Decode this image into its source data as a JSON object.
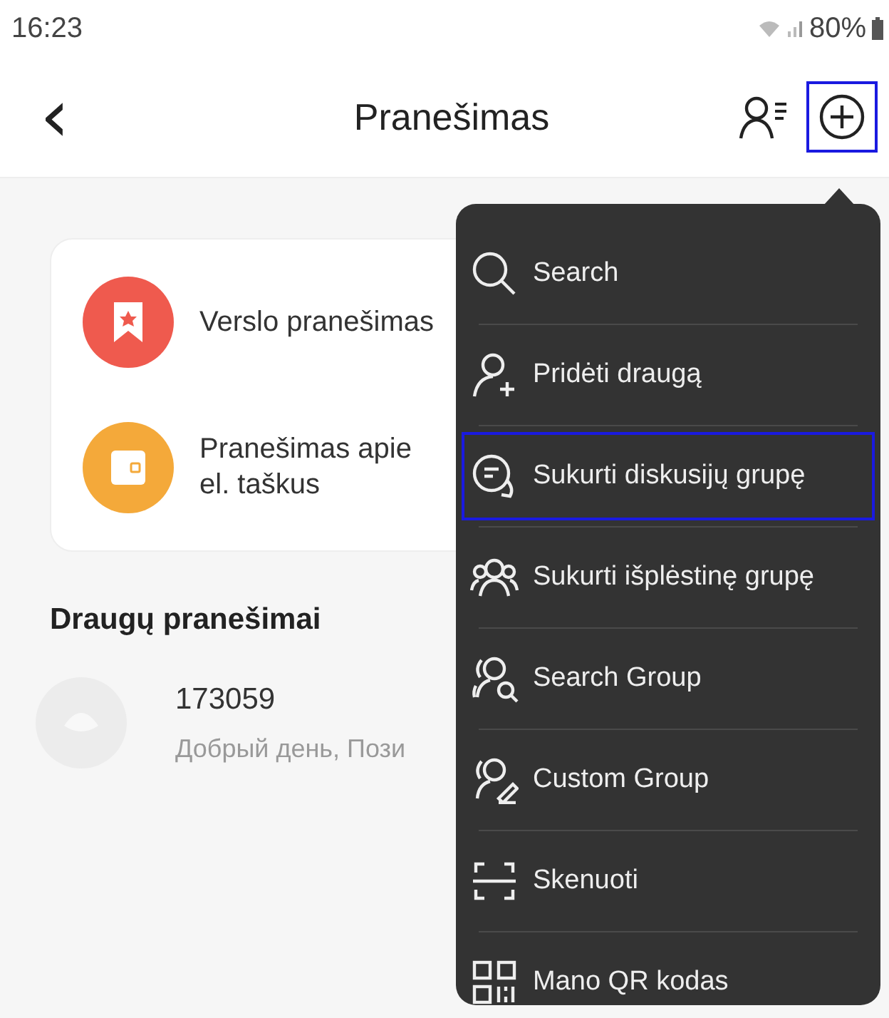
{
  "status_bar": {
    "time": "16:23",
    "battery": "80%"
  },
  "header": {
    "title": "Pranešimas",
    "back_icon": "‹",
    "add_button": {
      "highlighted": true
    }
  },
  "categories": [
    {
      "label": "Verslo pranešimas",
      "kind": "bookmark",
      "color": "#ef5a4e"
    },
    {
      "label": "Pranešimas apie el. taškus",
      "kind": "wallet",
      "color": "#f4a93a"
    }
  ],
  "friends_section": {
    "title": "Draugų pranešimai",
    "conversations": [
      {
        "name": "173059",
        "preview": "Добрый день, Пози"
      }
    ]
  },
  "menu": {
    "items": [
      {
        "label": "Search",
        "kind": "search",
        "highlighted": false
      },
      {
        "label": "Pridėti draugą",
        "kind": "add-friend",
        "highlighted": false
      },
      {
        "label": "Sukurti diskusijų grupę",
        "kind": "chat",
        "highlighted": true
      },
      {
        "label": "Sukurti išplėstinę grupę",
        "kind": "group",
        "highlighted": false
      },
      {
        "label": "Search Group",
        "kind": "group-search",
        "highlighted": false
      },
      {
        "label": "Custom Group",
        "kind": "group-edit",
        "highlighted": false
      },
      {
        "label": "Skenuoti",
        "kind": "scan",
        "highlighted": false
      },
      {
        "label": "Mano QR kodas",
        "kind": "qr",
        "highlighted": false
      }
    ]
  }
}
